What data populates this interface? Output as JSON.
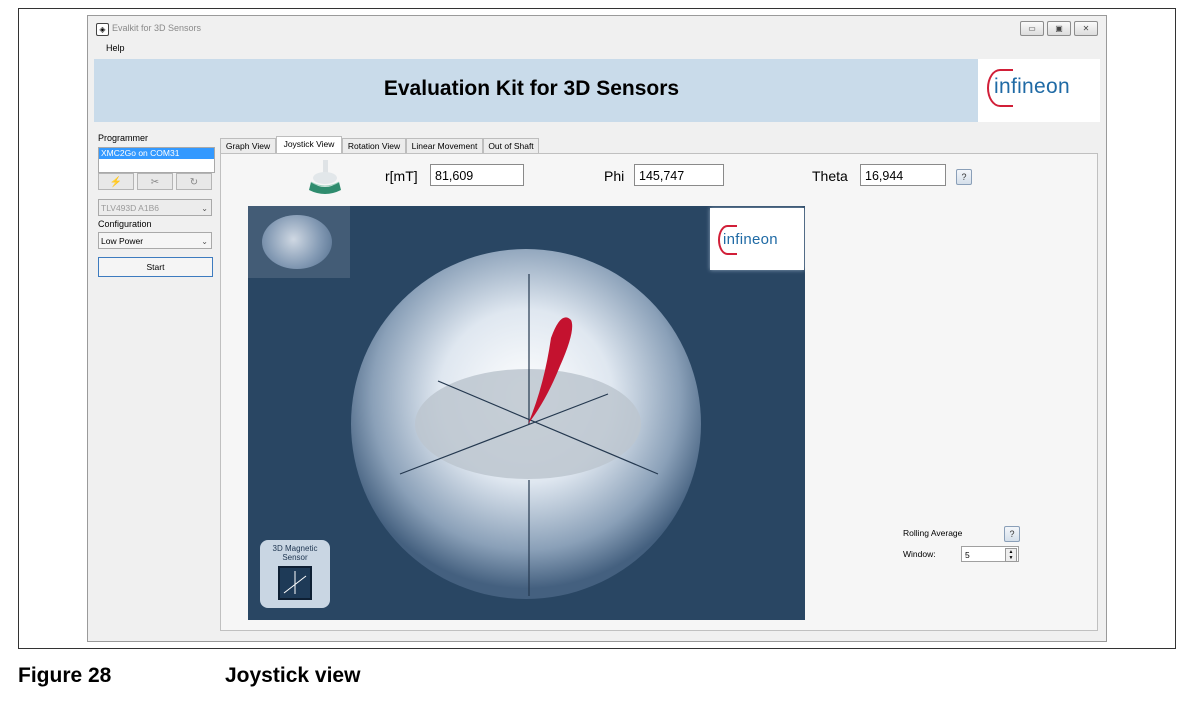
{
  "window": {
    "title": "Evalkit for 3D Sensors",
    "controls": [
      "▭",
      "▣",
      "✕"
    ]
  },
  "menu": {
    "help": "Help"
  },
  "banner": {
    "title": "Evaluation Kit for 3D Sensors",
    "logo": "infineon"
  },
  "left_panel": {
    "programmer_label": "Programmer",
    "programmer_selected": "XMC2Go on COM31",
    "toolbar": [
      {
        "icon": "plug-icon",
        "glyph": "⚡"
      },
      {
        "icon": "disconnect-icon",
        "glyph": "✂"
      },
      {
        "icon": "refresh-icon",
        "glyph": "↻"
      }
    ],
    "sensor_value": "TLV493D A1B6",
    "configuration_label": "Configuration",
    "configuration_value": "Low Power",
    "start_label": "Start"
  },
  "tabs": [
    {
      "label": "Graph View",
      "active": false
    },
    {
      "label": "Joystick View",
      "active": true
    },
    {
      "label": "Rotation View",
      "active": false
    },
    {
      "label": "Linear Movement",
      "active": false
    },
    {
      "label": "Out of Shaft",
      "active": false
    }
  ],
  "readouts": {
    "r_label": "r[mT]",
    "r_value": "81,609",
    "phi_label": "Phi",
    "phi_value": "145,747",
    "theta_label": "Theta",
    "theta_value": "16,944",
    "help": "?"
  },
  "canvas": {
    "logo": "infineon",
    "chip_label_line1": "3D Magnetic",
    "chip_label_line2": "Sensor",
    "sphere_color": "#dfe7f0",
    "vector_color": "#c4122f",
    "background": "#294663"
  },
  "rolling_average": {
    "label": "Rolling Average",
    "window_label": "Window:",
    "window_value": "5",
    "help": "?"
  },
  "figure": {
    "number": "Figure 28",
    "caption": "Joystick view"
  }
}
